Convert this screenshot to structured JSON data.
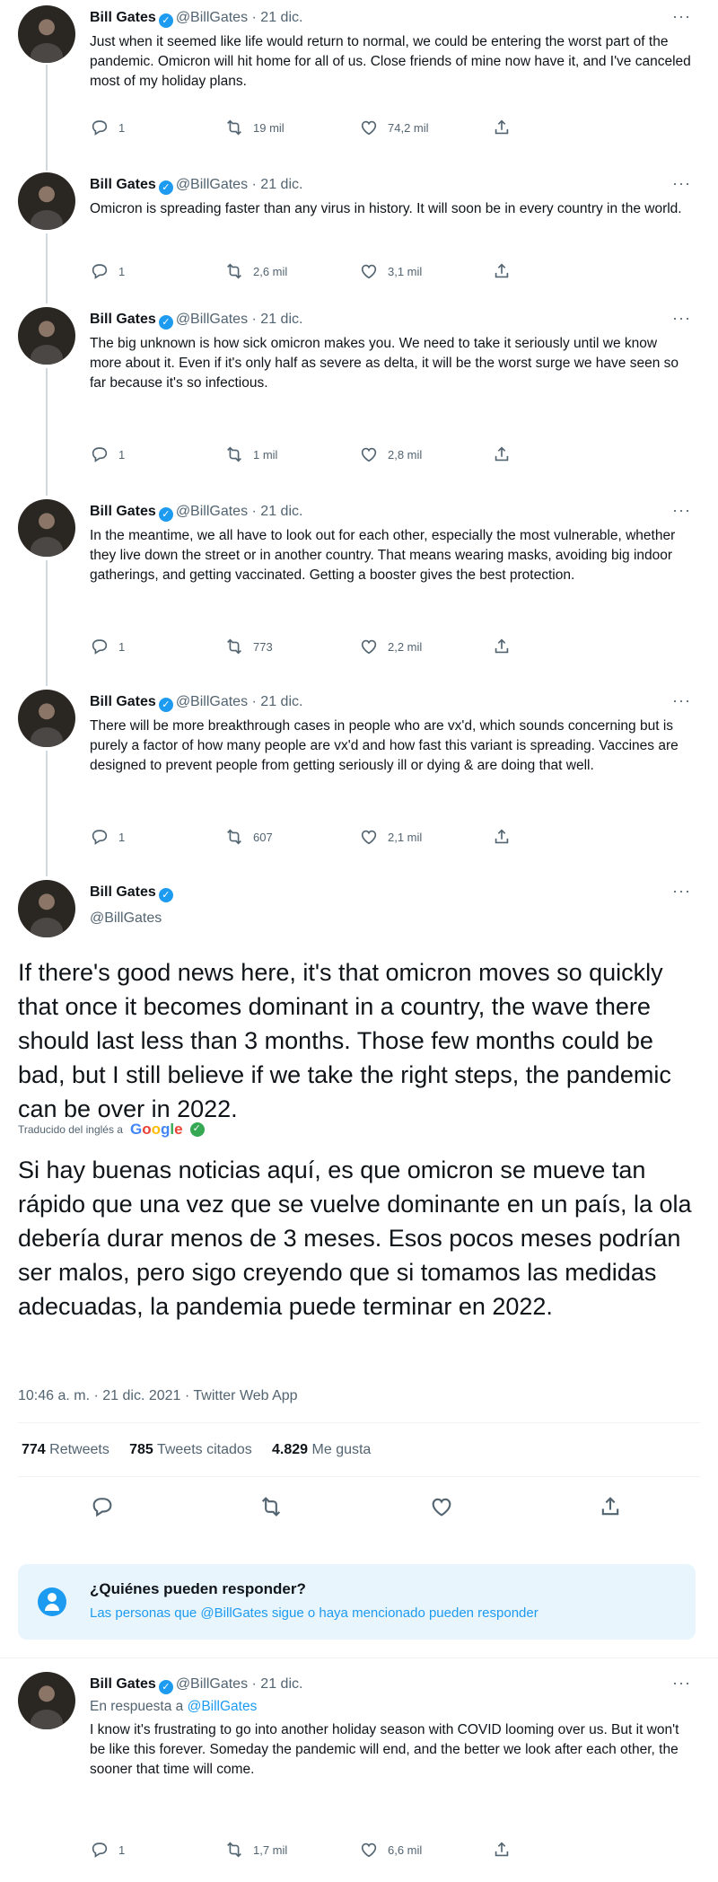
{
  "author": {
    "name": "Bill Gates",
    "handle": "@BillGates",
    "dot_date": "· 21 dic."
  },
  "thread": [
    {
      "text": "Just when it seemed like life would return to normal, we could be entering the worst part of the pandemic. Omicron will hit home for all of us. Close friends of mine now have it, and I've canceled most of my holiday plans.",
      "replies": "1",
      "retweets": "19 mil",
      "likes": "74,2 mil"
    },
    {
      "text": "Omicron is spreading faster than any virus in history. It will soon be in every country in the world.",
      "replies": "1",
      "retweets": "2,6 mil",
      "likes": "3,1 mil"
    },
    {
      "text": "The big unknown is how sick omicron makes you. We need to take it seriously until we know more about it. Even if it's only half as severe as delta, it will be the worst surge we have seen so far because it's so infectious.",
      "replies": "1",
      "retweets": "1 mil",
      "likes": "2,8 mil"
    },
    {
      "text": "In the meantime, we all have to look out for each other, especially the most vulnerable, whether they live down the street or in another country. That means wearing masks, avoiding big indoor gatherings, and getting vaccinated. Getting a booster gives the best protection.",
      "replies": "1",
      "retweets": "773",
      "likes": "2,2 mil"
    },
    {
      "text": "There will be more breakthrough cases in people who are vx'd, which sounds concerning but is purely a factor of how many people are vx'd and how fast this variant is spreading. Vaccines are designed to prevent people from getting seriously ill or dying & are doing that well.",
      "replies": "1",
      "retweets": "607",
      "likes": "2,1 mil"
    }
  ],
  "main_tweet": {
    "text": "If there's good news here, it's that omicron moves so quickly that once it becomes dominant in a country, the wave there should last less than 3 months. Those few months could be bad, but I still believe if we take the right steps, the pandemic can be over in 2022.",
    "translated_by": "Traducido del inglés a",
    "google": [
      "G",
      "o",
      "o",
      "g",
      "l",
      "e"
    ],
    "translation": "Si hay buenas noticias aquí, es que omicron se mueve tan rápido que una vez que se vuelve dominante en un país, la ola debería durar menos de 3 meses. Esos pocos meses podrían ser malos, pero sigo creyendo que si tomamos las medidas adecuadas, la pandemia puede terminar en 2022.",
    "timestamp": "10:46 a. m. · 21 dic. 2021 · Twitter Web App",
    "retweets_count": "774",
    "retweets_label": "Retweets",
    "quotes_count": "785",
    "quotes_label": "Tweets citados",
    "likes_count": "4.829",
    "likes_label": "Me gusta"
  },
  "reply_restriction": {
    "title": "¿Quiénes pueden responder?",
    "subtitle": "Las personas que @BillGates sigue o haya mencionado pueden responder"
  },
  "reply": {
    "replying_prefix": "En respuesta a",
    "replying_to": "@BillGates",
    "text": "I know it's frustrating to go into another holiday season with COVID looming over us. But it won't be like this forever. Someday the pandemic will end, and the better we look after each other, the sooner that time will come.",
    "replies": "1",
    "retweets": "1,7 mil",
    "likes": "6,6 mil"
  },
  "icons": {
    "reply": "reply-icon",
    "retweet": "retweet-icon",
    "like": "heart-icon",
    "share": "share-icon",
    "more": "more-icon",
    "verified": "verified-badge-icon"
  },
  "colors": {
    "accent": "#1d9bf0",
    "muted": "#536471",
    "text": "#0f1419"
  },
  "more_glyph": "···",
  "verified_glyph": "✓"
}
